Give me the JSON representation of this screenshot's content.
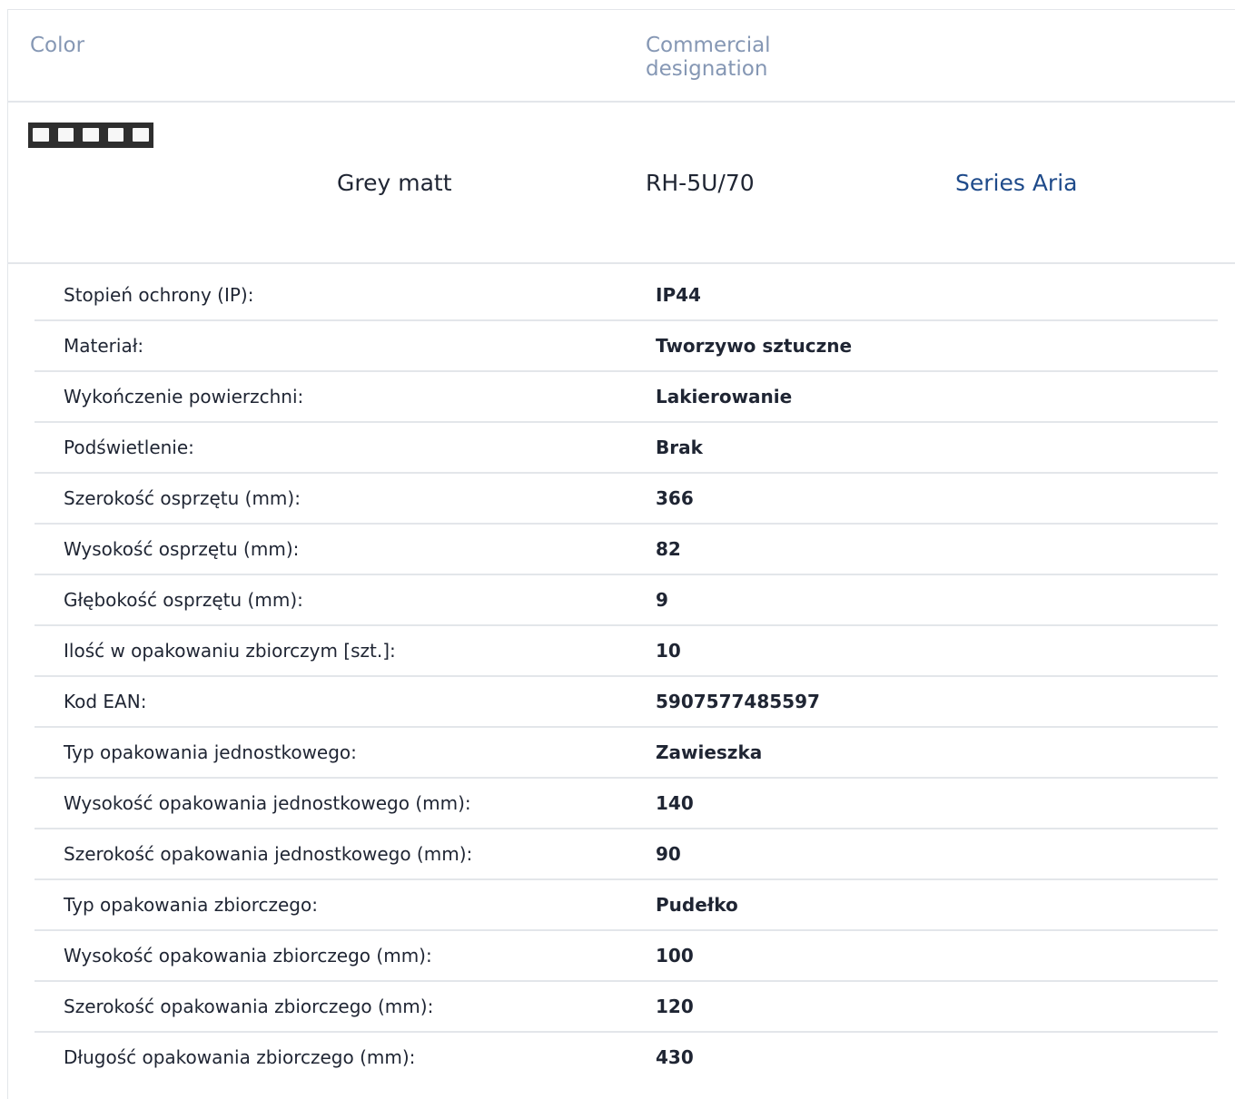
{
  "header": {
    "color_label": "Color",
    "designation_label": "Commercial designation"
  },
  "product": {
    "swatch_icon": "five-gang-frame-icon",
    "swatch_color": "#2e2e2e",
    "color_name": "Grey matt",
    "designation": "RH-5U/70",
    "series_link": "Series Aria",
    "link_color": "#1e4a8a"
  },
  "specs": [
    {
      "label": "Stopień ochrony (IP):",
      "value": "IP44"
    },
    {
      "label": "Materiał:",
      "value": "Tworzywo sztuczne"
    },
    {
      "label": "Wykończenie powierzchni:",
      "value": "Lakierowanie"
    },
    {
      "label": "Podświetlenie:",
      "value": "Brak"
    },
    {
      "label": "Szerokość osprzętu (mm):",
      "value": "366"
    },
    {
      "label": "Wysokość osprzętu (mm):",
      "value": "82"
    },
    {
      "label": "Głębokość osprzętu (mm):",
      "value": "9"
    },
    {
      "label": "Ilość w opakowaniu zbiorczym [szt.]:",
      "value": "10"
    },
    {
      "label": "Kod EAN:",
      "value": "5907577485597"
    },
    {
      "label": "Typ opakowania jednostkowego:",
      "value": "Zawieszka"
    },
    {
      "label": "Wysokość opakowania jednostkowego (mm):",
      "value": "140"
    },
    {
      "label": "Szerokość opakowania jednostkowego (mm):",
      "value": "90"
    },
    {
      "label": "Typ opakowania zbiorczego:",
      "value": "Pudełko"
    },
    {
      "label": "Wysokość opakowania zbiorczego (mm):",
      "value": "100"
    },
    {
      "label": "Szerokość opakowania zbiorczego (mm):",
      "value": "120"
    },
    {
      "label": "Długość opakowania zbiorczego (mm):",
      "value": "430"
    }
  ]
}
